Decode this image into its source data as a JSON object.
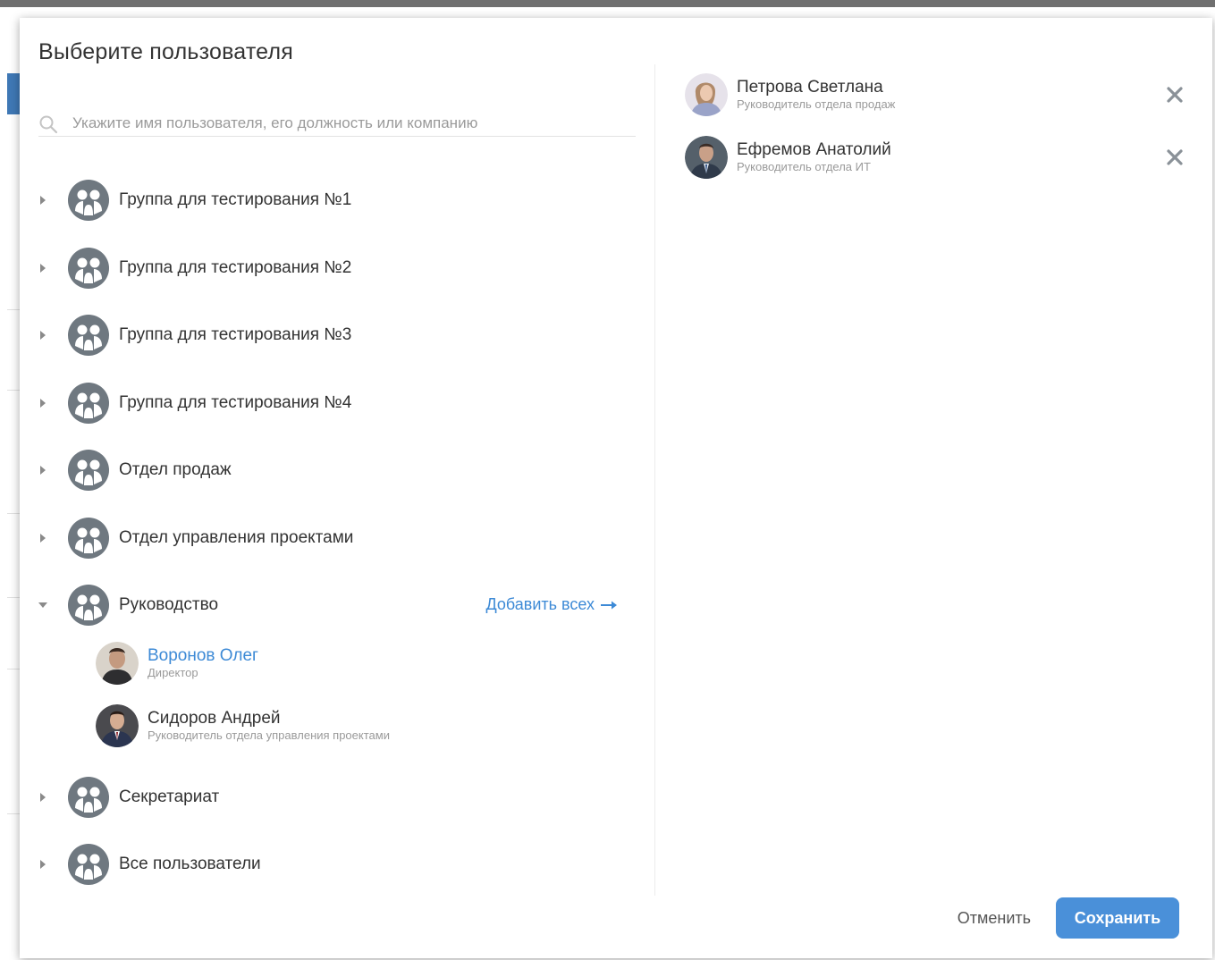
{
  "modal": {
    "title": "Выберите пользователя",
    "search": {
      "placeholder": "Укажите имя пользователя, его должность или компанию",
      "value": ""
    }
  },
  "groups": [
    {
      "label": "Группа для тестирования №1",
      "expanded": false
    },
    {
      "label": "Группа для тестирования №2",
      "expanded": false
    },
    {
      "label": "Группа для тестирования №3",
      "expanded": false
    },
    {
      "label": "Группа для тестирования №4",
      "expanded": false
    },
    {
      "label": "Отдел продаж",
      "expanded": false
    },
    {
      "label": "Отдел управления проектами",
      "expanded": false
    },
    {
      "label": "Руководство",
      "expanded": true,
      "add_all_label": "Добавить всех"
    },
    {
      "label": "Секретариат",
      "expanded": false
    },
    {
      "label": "Все пользователи",
      "expanded": false
    }
  ],
  "members": [
    {
      "name": "Воронов Олег",
      "role": "Директор",
      "highlighted": true
    },
    {
      "name": "Сидоров Андрей",
      "role": "Руководитель отдела управления проектами",
      "highlighted": false
    }
  ],
  "selected": [
    {
      "name": "Петрова Светлана",
      "role": "Руководитель отдела продаж"
    },
    {
      "name": "Ефремов Анатолий",
      "role": "Руководитель отдела ИТ"
    }
  ],
  "footer": {
    "cancel_label": "Отменить",
    "save_label": "Сохранить"
  },
  "colors": {
    "accent": "#4a90d9",
    "link": "#3d8ad6",
    "icon": "#6f7880"
  },
  "icons": {
    "search": "search-icon",
    "group": "group-icon",
    "remove": "close-icon",
    "arrow": "arrow-right-icon"
  }
}
